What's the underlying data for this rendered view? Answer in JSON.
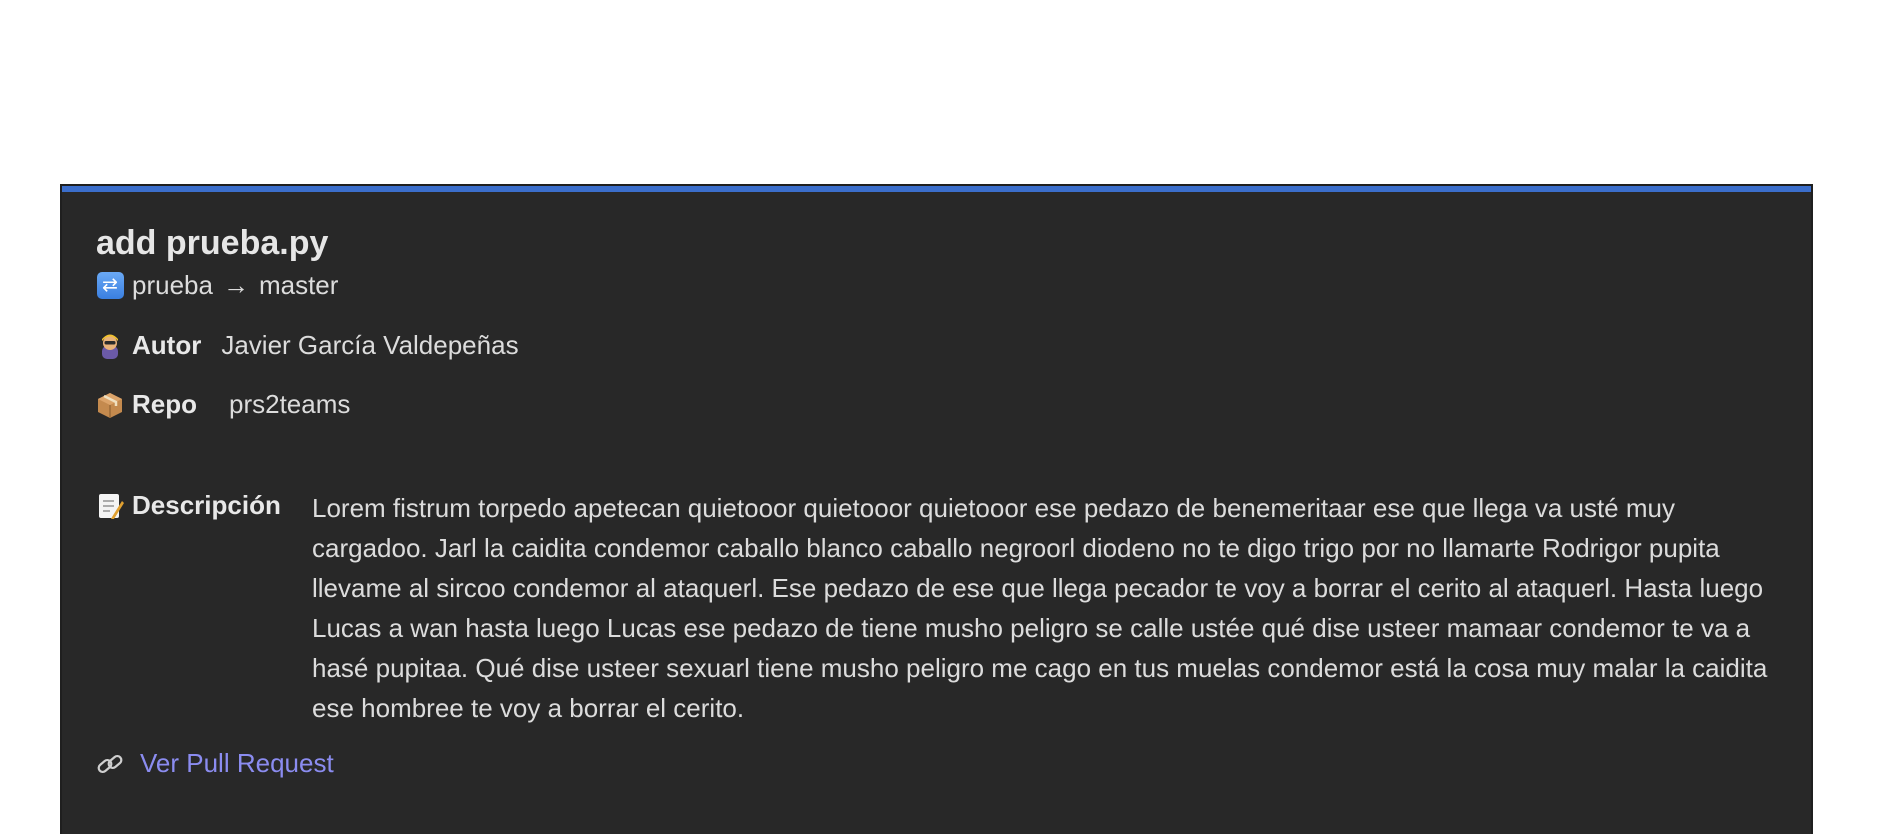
{
  "pr": {
    "title": "add prueba.py",
    "source_branch": "prueba",
    "arrow": "→",
    "target_branch": "master",
    "author_label": "Autor",
    "author": "Javier García Valdepeñas",
    "repo_label": "Repo",
    "repo": "prs2teams",
    "description_label": "Descripción",
    "description": "Lorem fistrum torpedo apetecan quietooor quietooor quietooor ese pedazo de benemeritaar ese que llega va usté muy cargadoo. Jarl la caidita condemor caballo blanco caballo negroorl diodeno no te digo trigo por no llamarte Rodrigor pupita llevame al sircoo condemor al ataquerl. Ese pedazo de ese que llega pecador te voy a borrar el cerito al ataquerl. Hasta luego Lucas a wan hasta luego Lucas ese pedazo de tiene musho peligro se calle ustée qué dise usteer mamaar condemor te va a hasé pupitaa. Qué dise usteer sexuarl tiene musho peligro me cago en tus muelas condemor está la cosa muy malar la caidita ese hombree te voy a borrar el cerito.",
    "link_text": "Ver Pull Request"
  },
  "icons": {
    "branch": "shuffle-icon",
    "author": "person-icon",
    "repo": "package-icon",
    "description": "memo-icon",
    "link": "link-icon"
  },
  "colors": {
    "card_background": "#282828",
    "accent": "#3b6ecb",
    "link": "#8b8cf0",
    "text": "#dcdcdc"
  }
}
